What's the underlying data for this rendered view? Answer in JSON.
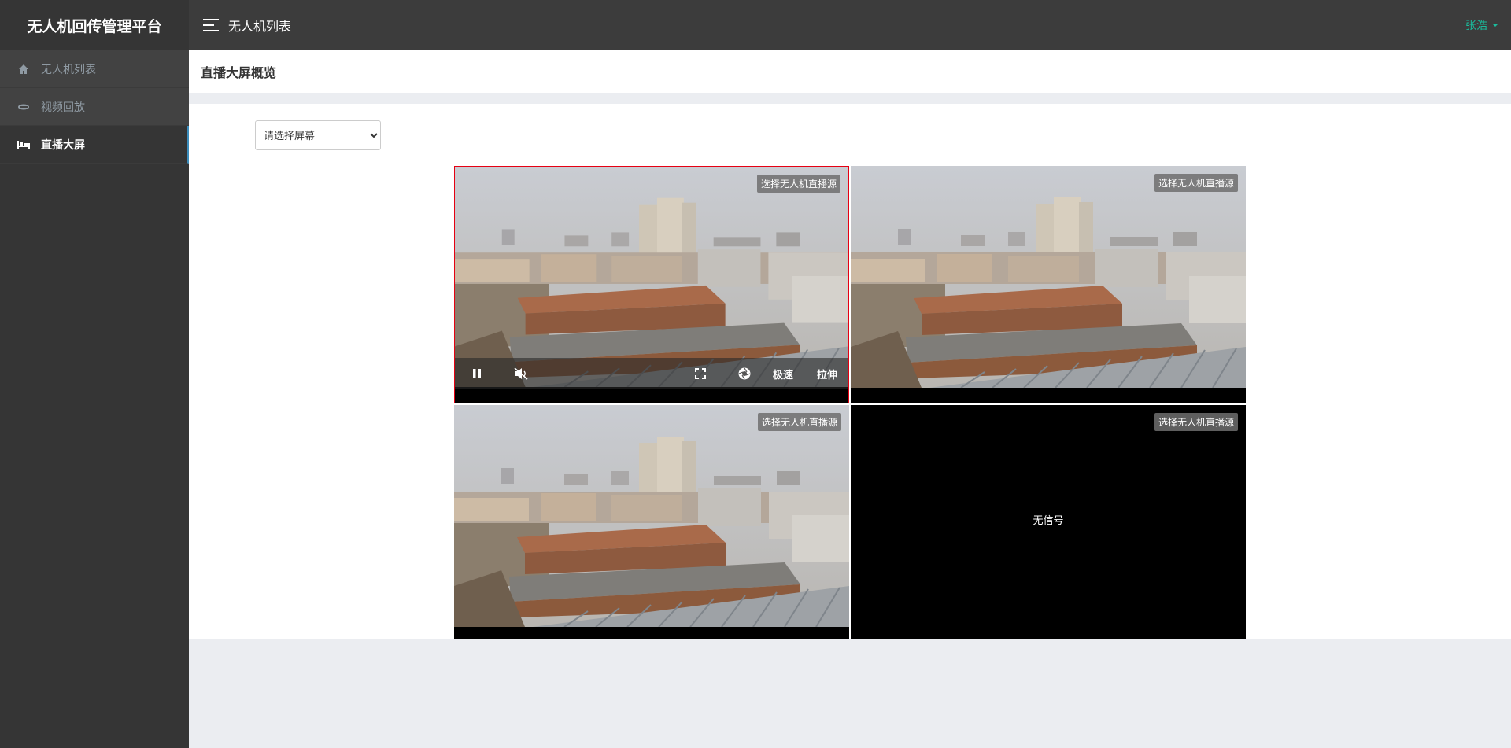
{
  "brand": "无人机回传管理平台",
  "sidebar": {
    "items": [
      {
        "label": "无人机列表",
        "icon": "home-icon",
        "active": false
      },
      {
        "label": "视频回放",
        "icon": "drone-icon",
        "active": false
      },
      {
        "label": "直播大屏",
        "icon": "bed-icon",
        "active": true
      }
    ]
  },
  "topbar": {
    "title": "无人机列表",
    "user": "张浩"
  },
  "page": {
    "title": "直播大屏概览"
  },
  "screen_select": {
    "selected": "请选择屏幕"
  },
  "videos": [
    {
      "source_button": "选择无人机直播源",
      "has_signal": true,
      "selected": true
    },
    {
      "source_button": "选择无人机直播源",
      "has_signal": true,
      "selected": false
    },
    {
      "source_button": "选择无人机直播源",
      "has_signal": true,
      "selected": false
    },
    {
      "source_button": "选择无人机直播源",
      "has_signal": false,
      "status": "无信号",
      "selected": false
    }
  ],
  "player_controls": {
    "speed": "极速",
    "stretch": "拉伸"
  },
  "colors": {
    "sidebar_bg": "#353535",
    "topbar_bg": "#3c3c3c",
    "accent": "#1abc9c",
    "selected_border": "#e60012"
  }
}
